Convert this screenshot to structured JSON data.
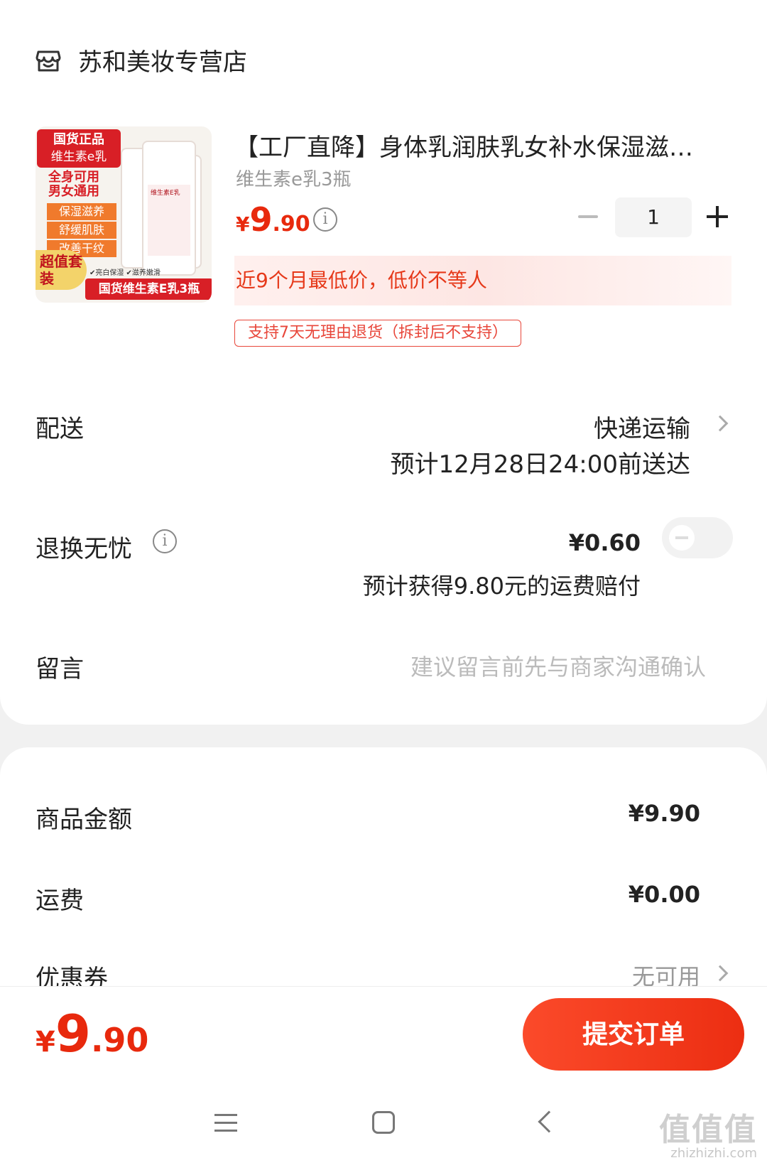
{
  "shop": {
    "name": "苏和美妆专营店",
    "icon": "store-icon"
  },
  "product": {
    "title": "【工厂直降】身体乳润肤乳女补水保湿滋…",
    "spec": "维生素e乳3瓶",
    "price": {
      "currency": "¥",
      "integer": "9",
      "decimal": ".90"
    },
    "quantity": "1",
    "low_price_note": "近9个月最低价，低价不等人",
    "return_tag": "支持7天无理由退货（拆封后不支持）",
    "image": {
      "tag_line1": "国货正品",
      "tag_line2": "维生素e乳",
      "line_a": "全身可用",
      "line_b": "男女通用",
      "pills": [
        "保湿滋养",
        "舒缓肌肤",
        "改善干纹"
      ],
      "bottle_label": "维生素E乳",
      "badge": "超值套装",
      "mini_note": "✔亮白保湿 ✔滋养嫩滑",
      "banner": "国货维生素E乳3瓶"
    }
  },
  "delivery": {
    "label": "配送",
    "method": "快递运输",
    "eta": "预计12月28日24:00前送达"
  },
  "exchange": {
    "label": "退换无忧",
    "fee": "¥0.60",
    "subtext": "预计获得9.80元的运费赔付",
    "enabled": false
  },
  "message": {
    "label": "留言",
    "placeholder": "建议留言前先与商家沟通确认"
  },
  "summary": {
    "goods_label": "商品金额",
    "goods_value": "¥9.90",
    "shipping_label": "运费",
    "shipping_value": "¥0.00",
    "coupon_label": "优惠券",
    "coupon_value": "无可用"
  },
  "footer": {
    "total": {
      "currency": "¥",
      "integer": "9",
      "decimal": ".90"
    },
    "submit_label": "提交订单"
  },
  "watermark": {
    "big": "值值值",
    "small": "zhizhizhi.com"
  },
  "colors": {
    "accent": "#e8290d",
    "submit": "#f23a1c",
    "low_price_bg": "#fde6e3"
  }
}
